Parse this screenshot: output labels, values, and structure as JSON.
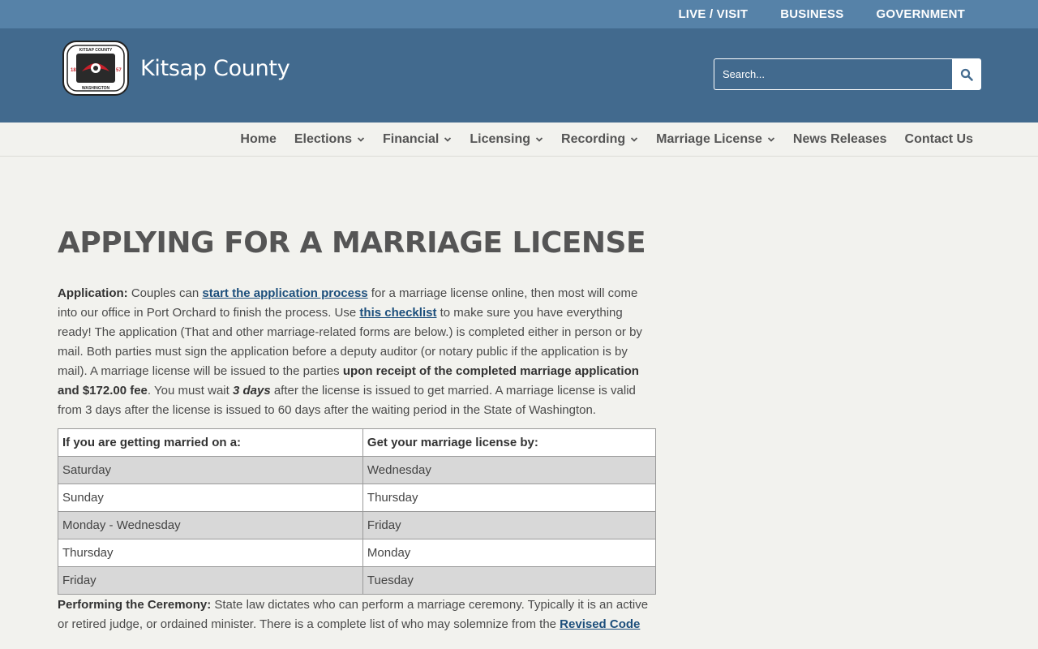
{
  "topbar": {
    "links": [
      "LIVE / VISIT",
      "BUSINESS",
      "GOVERNMENT"
    ]
  },
  "header": {
    "site_title": "Kitsap County",
    "logo_top_text": "KITSAP COUNTY",
    "logo_bottom_text": "WASHINGTON",
    "search_placeholder": "Search..."
  },
  "nav": {
    "items": [
      {
        "label": "Home",
        "dropdown": false
      },
      {
        "label": "Elections",
        "dropdown": true
      },
      {
        "label": "Financial",
        "dropdown": true
      },
      {
        "label": "Licensing",
        "dropdown": true
      },
      {
        "label": "Recording",
        "dropdown": true
      },
      {
        "label": "Marriage License",
        "dropdown": true
      },
      {
        "label": "News Releases",
        "dropdown": false
      },
      {
        "label": "Contact Us",
        "dropdown": false
      }
    ]
  },
  "main": {
    "title": "APPLYING FOR A MARRIAGE LICENSE",
    "application": {
      "label": "Application:",
      "t1": " Couples can ",
      "link1": "start the application process",
      "t2": " for a marriage license online, then most will  come into our office in Port Orchard to finish the process. Use ",
      "link2": "this checklist",
      "t3": " to make sure you have everything ready!  The application (That and other marriage-related  forms are  below.)  is completed either in person or by mail. Both parties must sign the application before a deputy auditor (or notary public if the application is by mail). A marriage license will be issued to the parties ",
      "bold1": "upon receipt of the completed marriage application  and $172.00 fee",
      "t4": ".  You must wait ",
      "bold2": "3 days",
      "t5": " after the license is issued to get married. A marriage license is valid from 3 days after the license is issued to  60 days after the waiting period  in the State  of Washington."
    },
    "table": {
      "headers": [
        "If you are getting married on a:",
        "Get your marriage license by:"
      ],
      "rows": [
        [
          "Saturday",
          "Wednesday"
        ],
        [
          "Sunday",
          "Thursday"
        ],
        [
          "Monday - Wednesday",
          "Friday"
        ],
        [
          "Thursday",
          "Monday"
        ],
        [
          "Friday",
          "Tuesday"
        ]
      ]
    },
    "ceremony": {
      "label": "Performing the Ceremony:",
      "t1": " State law dictates who can perform a marriage ceremony. Typically it is an active or retired judge,  or ordained minister. There is a complete list of who may solemnize  from the ",
      "link": "Revised Code"
    }
  },
  "colors": {
    "topbar": "#5682a8",
    "header": "#426a8e",
    "background": "#f2f2ee",
    "link": "#1d4f7c"
  }
}
